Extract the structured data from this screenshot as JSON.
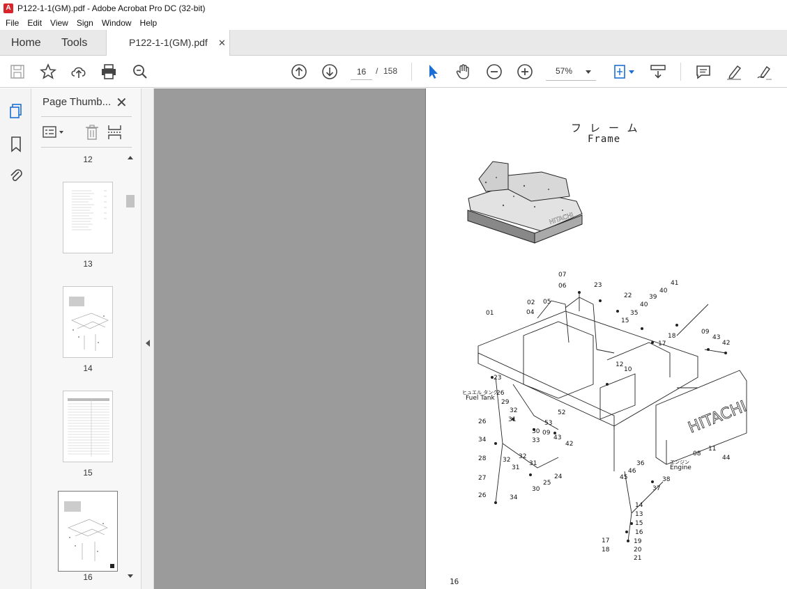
{
  "window": {
    "title": "P122-1-1(GM).pdf - Adobe Acrobat Pro DC (32-bit)"
  },
  "menu": [
    "File",
    "Edit",
    "View",
    "Sign",
    "Window",
    "Help"
  ],
  "tabs": {
    "home": "Home",
    "tools": "Tools",
    "document": "P122-1-1(GM).pdf",
    "close": "✕"
  },
  "toolbar": {
    "page_current": "16",
    "page_sep": "/",
    "page_total": "158",
    "zoom": "57%"
  },
  "panel": {
    "title": "Page Thumb...",
    "close": "✕",
    "thumbnails": [
      {
        "label": "12"
      },
      {
        "label": "13"
      },
      {
        "label": "14"
      },
      {
        "label": "15"
      },
      {
        "label": "16"
      }
    ]
  },
  "document": {
    "title_jp": "フレーム",
    "title_en": "Frame",
    "footer": "16",
    "labels": {
      "fuel_tank_jp": "ヒュエル タンク",
      "fuel_tank_en": "Fuel Tank",
      "engine_jp": "エンジン",
      "engine_en": "Engine",
      "brand": "HITACHI"
    },
    "callouts": [
      "07",
      "06",
      "23",
      "22",
      "41",
      "40",
      "39",
      "02",
      "05",
      "40",
      "04",
      "35",
      "15",
      "18",
      "17",
      "01",
      "09",
      "43",
      "42",
      "12",
      "10",
      "23",
      "26",
      "29",
      "52",
      "32",
      "31",
      "53",
      "09",
      "43",
      "26",
      "30",
      "33",
      "42",
      "34",
      "08",
      "11",
      "44",
      "28",
      "32",
      "32",
      "31",
      "31",
      "36",
      "24",
      "27",
      "25",
      "46",
      "45",
      "38",
      "30",
      "37",
      "26",
      "34",
      "14",
      "13",
      "15",
      "16",
      "17",
      "19",
      "18",
      "20",
      "21"
    ]
  }
}
